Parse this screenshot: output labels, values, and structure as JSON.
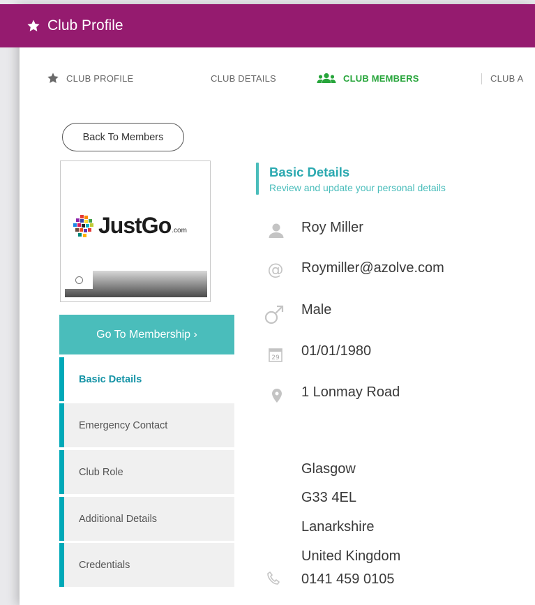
{
  "titlebar": {
    "title": "Club Profile",
    "icon": "star-icon"
  },
  "tabs": [
    {
      "label": "CLUB PROFILE",
      "icon": "star-icon"
    },
    {
      "label": "CLUB DETAILS"
    },
    {
      "label": "CLUB MEMBERS",
      "icon": "users-icon",
      "active": true
    },
    {
      "label": "CLUB A"
    }
  ],
  "back_button": {
    "label": "Back To Members"
  },
  "logo": {
    "text": "JustGo",
    "suffix": ".com"
  },
  "goto_button": {
    "label": "Go To Membership ›"
  },
  "sidebar": {
    "items": [
      {
        "label": "Basic Details",
        "active": true
      },
      {
        "label": "Emergency Contact"
      },
      {
        "label": "Club Role"
      },
      {
        "label": "Additional Details"
      },
      {
        "label": "Credentials"
      }
    ]
  },
  "section": {
    "title": "Basic Details",
    "subtitle": "Review and update your personal details"
  },
  "fields": {
    "name": "Roy Miller",
    "email": "Roymiller@azolve.com",
    "gender": "Male",
    "dob": "01/01/1980",
    "calendar_day": "29",
    "address_line1": "1 Lonmay Road",
    "city": "Glasgow",
    "postcode": "G33 4EL",
    "county": "Lanarkshire",
    "country": "United Kingdom",
    "phone": "0141 459 0105"
  },
  "colors": {
    "titlebar": "#951b6f",
    "active_tab": "#27a53b",
    "accent_teal": "#4abdbb",
    "sidebar_border": "#00a9b8",
    "icon_gray": "#c4c4c4"
  }
}
